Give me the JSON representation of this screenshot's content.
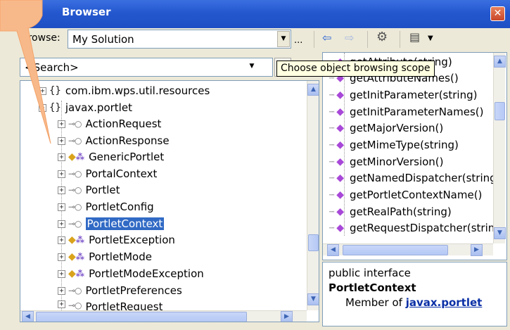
{
  "window": {
    "title": "Browser",
    "close_glyph": "✕"
  },
  "toolbar": {
    "browse_label": "Browse:",
    "browse_value": "My Solution",
    "ellipsis": "...",
    "back_icon": "back-arrow-icon",
    "forward_icon": "forward-arrow-icon",
    "settings_icon": "browser-settings-icon",
    "view_icon": "object-browser-view-icon"
  },
  "search": {
    "value": "<Search>"
  },
  "tooltip": "Choose object browsing scope",
  "tree": [
    {
      "label": "com.ibm.wps.util.resources",
      "kind": "namespace",
      "expanded": false
    },
    {
      "label": "javax.portlet",
      "kind": "namespace",
      "expanded": true
    },
    {
      "label": "ActionRequest",
      "kind": "interface"
    },
    {
      "label": "ActionResponse",
      "kind": "interface"
    },
    {
      "label": "GenericPortlet",
      "kind": "class"
    },
    {
      "label": "PortalContext",
      "kind": "interface"
    },
    {
      "label": "Portlet",
      "kind": "interface"
    },
    {
      "label": "PortletConfig",
      "kind": "interface"
    },
    {
      "label": "PortletContext",
      "kind": "interface",
      "selected": true
    },
    {
      "label": "PortletException",
      "kind": "class"
    },
    {
      "label": "PortletMode",
      "kind": "class"
    },
    {
      "label": "PortletModeException",
      "kind": "class"
    },
    {
      "label": "PortletPreferences",
      "kind": "interface"
    },
    {
      "label": "PortletRequest",
      "kind": "interface"
    }
  ],
  "members": [
    "getAttribute(string)",
    "getAttributeNames()",
    "getInitParameter(string)",
    "getInitParameterNames()",
    "getMajorVersion()",
    "getMimeType(string)",
    "getMinorVersion()",
    "getNamedDispatcher(string)",
    "getPortletContextName()",
    "getRealPath(string)",
    "getRequestDispatcher(string)"
  ],
  "description": {
    "line1": "public interface",
    "name": "PortletContext",
    "member_of": "Member of ",
    "namespace": "javax.portlet"
  },
  "colors": {
    "titlebar": "#2457cf",
    "selection": "#316ac5",
    "callout": "#f8b98a",
    "tooltip_bg": "#ffffe1"
  }
}
